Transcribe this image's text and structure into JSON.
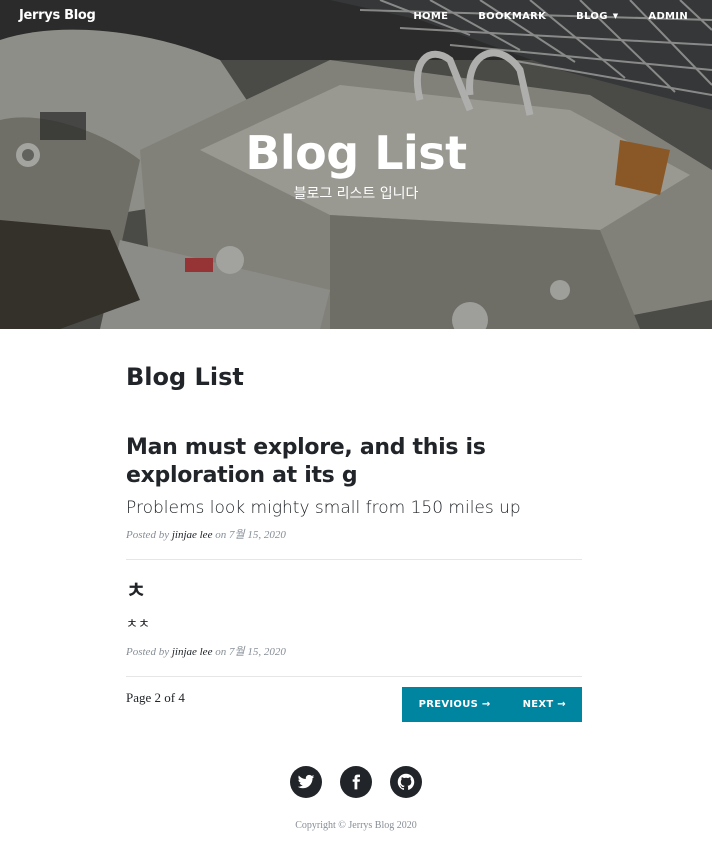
{
  "navbar": {
    "brand": "Jerrys Blog",
    "links": [
      {
        "label": "HOME"
      },
      {
        "label": "BOOKMARK"
      },
      {
        "label": "BLOG",
        "has_dropdown": true
      },
      {
        "label": "ADMIN"
      }
    ]
  },
  "hero": {
    "title": "Blog List",
    "subtitle": "블로그 리스트 입니다"
  },
  "main": {
    "heading": "Blog List",
    "posts": [
      {
        "title": "Man must explore, and this is exploration at its g",
        "subtitle": "Problems look mighty small from 150 miles up",
        "meta_prefix": "Posted by",
        "author": "jinjae lee",
        "meta_on": "on",
        "date": "7월 15, 2020"
      },
      {
        "title": "ㅊ",
        "subtitle": "ㅊㅊ",
        "meta_prefix": "Posted by",
        "author": "jinjae lee",
        "meta_on": "on",
        "date": "7월 15, 2020"
      }
    ],
    "pager": {
      "page_label": "Page 2 of 4",
      "previous_label": "PREVIOUS →",
      "next_label": "NEXT →"
    }
  },
  "footer": {
    "social": [
      {
        "icon": "twitter-icon"
      },
      {
        "icon": "facebook-icon"
      },
      {
        "icon": "github-icon"
      }
    ],
    "copyright": "Copyright © Jerrys Blog 2020"
  },
  "colors": {
    "accent": "#0085a1",
    "text": "#212529",
    "muted": "#868e96"
  }
}
